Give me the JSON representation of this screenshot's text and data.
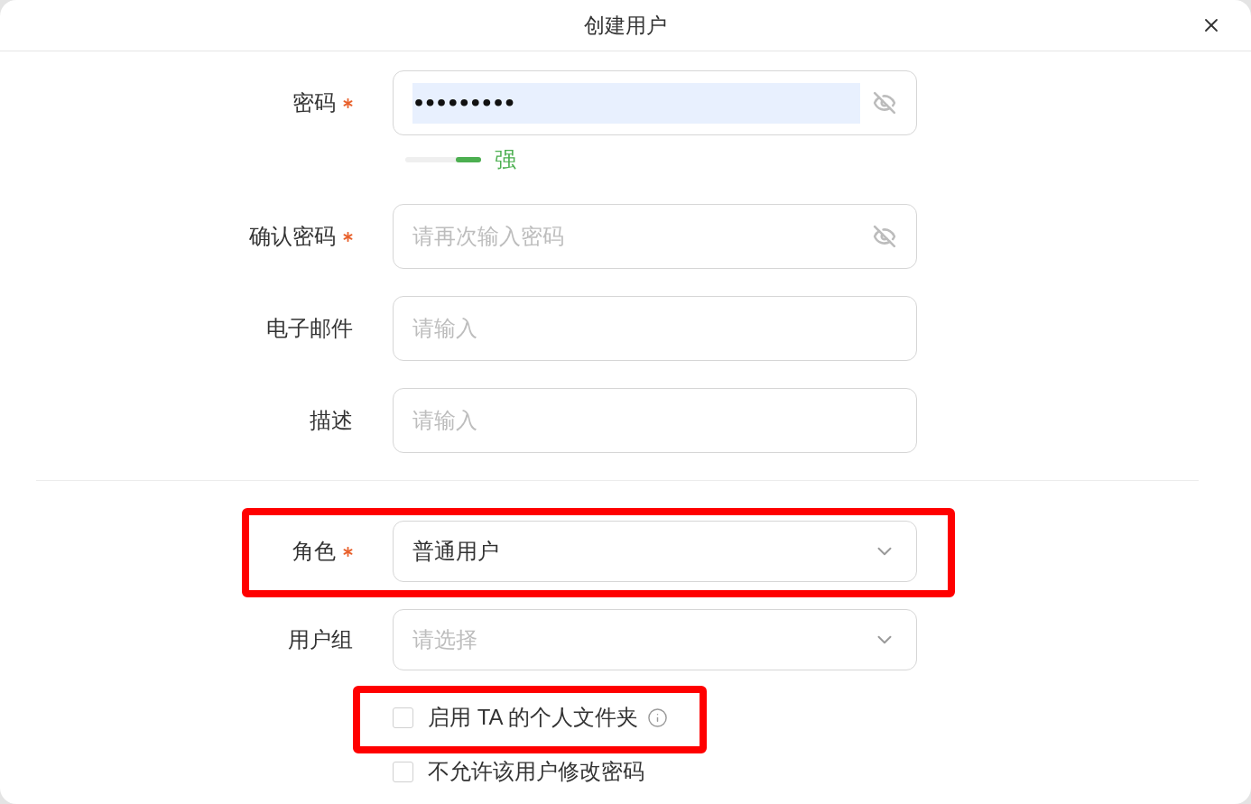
{
  "dialog": {
    "title": "创建用户"
  },
  "form": {
    "sections": [
      {
        "fields": [
          {
            "kind": "password",
            "label": "密码",
            "required": true,
            "value": "•••••••••",
            "autofilled": true,
            "highlighted": false,
            "strength": {
              "level": 1,
              "label": "强"
            }
          },
          {
            "kind": "password",
            "label": "确认密码",
            "required": true,
            "placeholder": "请再次输入密码",
            "highlighted": false
          },
          {
            "kind": "text",
            "label": "电子邮件",
            "required": false,
            "placeholder": "请输入",
            "highlighted": false
          },
          {
            "kind": "text",
            "label": "描述",
            "required": false,
            "placeholder": "请输入",
            "highlighted": false
          }
        ]
      },
      {
        "fields": [
          {
            "kind": "select",
            "label": "角色",
            "required": true,
            "value": "普通用户",
            "highlighted": true
          },
          {
            "kind": "select",
            "label": "用户组",
            "required": false,
            "placeholder": "请选择",
            "highlighted": false
          }
        ]
      }
    ],
    "checkboxes": [
      {
        "label": "启用 TA 的个人文件夹",
        "checked": false,
        "info": true,
        "highlighted": true
      },
      {
        "label": "不允许该用户修改密码",
        "checked": false,
        "info": false,
        "highlighted": false
      }
    ]
  }
}
